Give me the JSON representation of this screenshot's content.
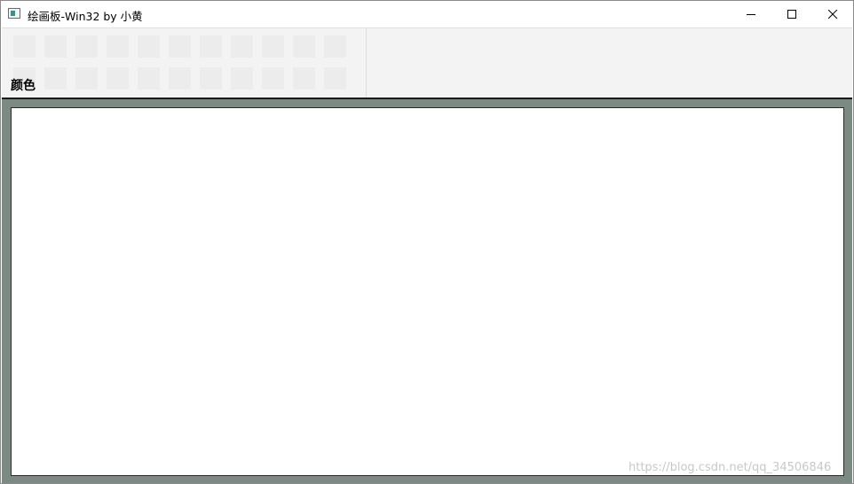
{
  "window": {
    "title": "绘画板-Win32 by 小黄"
  },
  "controls": {
    "minimize_icon": "minimize-icon",
    "maximize_icon": "maximize-icon",
    "close_icon": "close-icon"
  },
  "toolbar": {
    "color_label": "颜色",
    "swatch_rows": 2,
    "swatch_cols": 11
  },
  "watermark": "https://blog.csdn.net/qq_34506846",
  "colors": {
    "canvas_frame": "#7c8a84",
    "toolbar_bg": "#f3f3f3",
    "swatch": "#ececec",
    "canvas": "#ffffff"
  }
}
